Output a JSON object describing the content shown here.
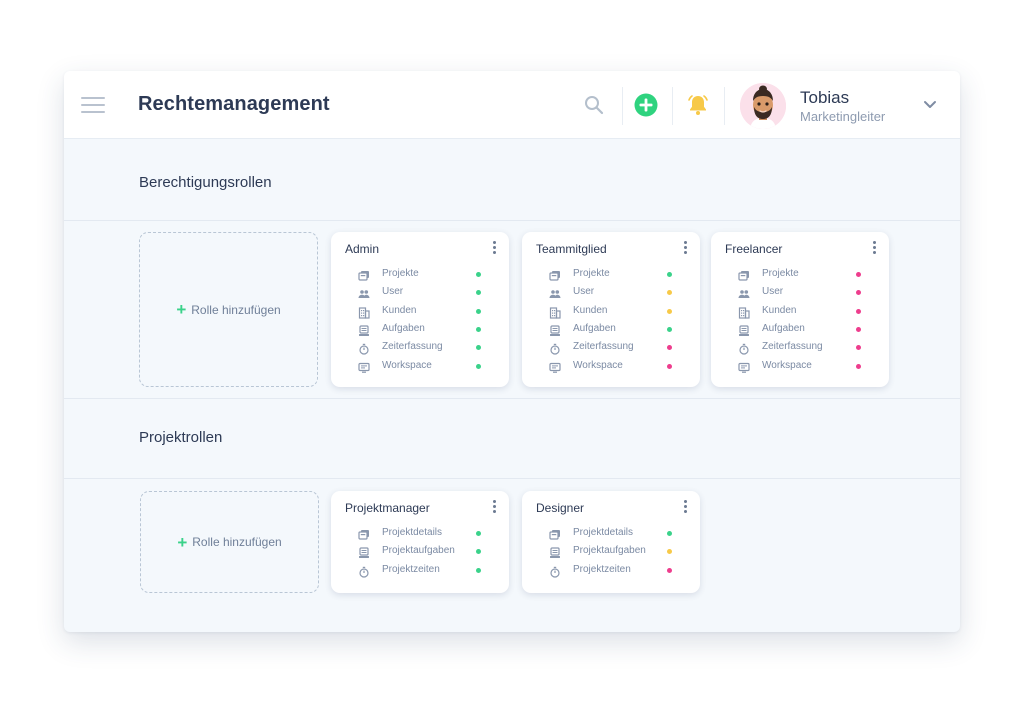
{
  "header": {
    "title": "Rechtemanagement",
    "user": {
      "name": "Tobias",
      "role": "Marketingleiter"
    }
  },
  "colors": {
    "green": "#3ad28a",
    "yellow": "#f7c948",
    "pink": "#ee3d8d",
    "accent_add": "#2fd37f",
    "bell": "#f7c948"
  },
  "sections": [
    {
      "title": "Berechtigungsrollen",
      "add_label": "Rolle hinzufügen",
      "roles": [
        {
          "name": "Admin",
          "permissions": [
            {
              "label": "Projekte",
              "icon": "stack-icon",
              "status": "green"
            },
            {
              "label": "User",
              "icon": "users-icon",
              "status": "green"
            },
            {
              "label": "Kunden",
              "icon": "building-icon",
              "status": "green"
            },
            {
              "label": "Aufgaben",
              "icon": "task-icon",
              "status": "green"
            },
            {
              "label": "Zeiterfassung",
              "icon": "stopwatch-icon",
              "status": "green"
            },
            {
              "label": "Workspace",
              "icon": "monitor-icon",
              "status": "green"
            }
          ]
        },
        {
          "name": "Teammitglied",
          "permissions": [
            {
              "label": "Projekte",
              "icon": "stack-icon",
              "status": "green"
            },
            {
              "label": "User",
              "icon": "users-icon",
              "status": "yellow"
            },
            {
              "label": "Kunden",
              "icon": "building-icon",
              "status": "yellow"
            },
            {
              "label": "Aufgaben",
              "icon": "task-icon",
              "status": "green"
            },
            {
              "label": "Zeiterfassung",
              "icon": "stopwatch-icon",
              "status": "pink"
            },
            {
              "label": "Workspace",
              "icon": "monitor-icon",
              "status": "pink"
            }
          ]
        },
        {
          "name": "Freelancer",
          "permissions": [
            {
              "label": "Projekte",
              "icon": "stack-icon",
              "status": "pink"
            },
            {
              "label": "User",
              "icon": "users-icon",
              "status": "pink"
            },
            {
              "label": "Kunden",
              "icon": "building-icon",
              "status": "pink"
            },
            {
              "label": "Aufgaben",
              "icon": "task-icon",
              "status": "pink"
            },
            {
              "label": "Zeiterfassung",
              "icon": "stopwatch-icon",
              "status": "pink"
            },
            {
              "label": "Workspace",
              "icon": "monitor-icon",
              "status": "pink"
            }
          ]
        }
      ]
    },
    {
      "title": "Projektrollen",
      "add_label": "Rolle hinzufügen",
      "roles": [
        {
          "name": "Projektmanager",
          "permissions": [
            {
              "label": "Projektdetails",
              "icon": "stack-icon",
              "status": "green"
            },
            {
              "label": "Projektaufgaben",
              "icon": "task-icon",
              "status": "green"
            },
            {
              "label": "Projektzeiten",
              "icon": "stopwatch-icon",
              "status": "green"
            }
          ]
        },
        {
          "name": "Designer",
          "permissions": [
            {
              "label": "Projektdetails",
              "icon": "stack-icon",
              "status": "green"
            },
            {
              "label": "Projektaufgaben",
              "icon": "task-icon",
              "status": "yellow"
            },
            {
              "label": "Projektzeiten",
              "icon": "stopwatch-icon",
              "status": "pink"
            }
          ]
        }
      ]
    }
  ]
}
